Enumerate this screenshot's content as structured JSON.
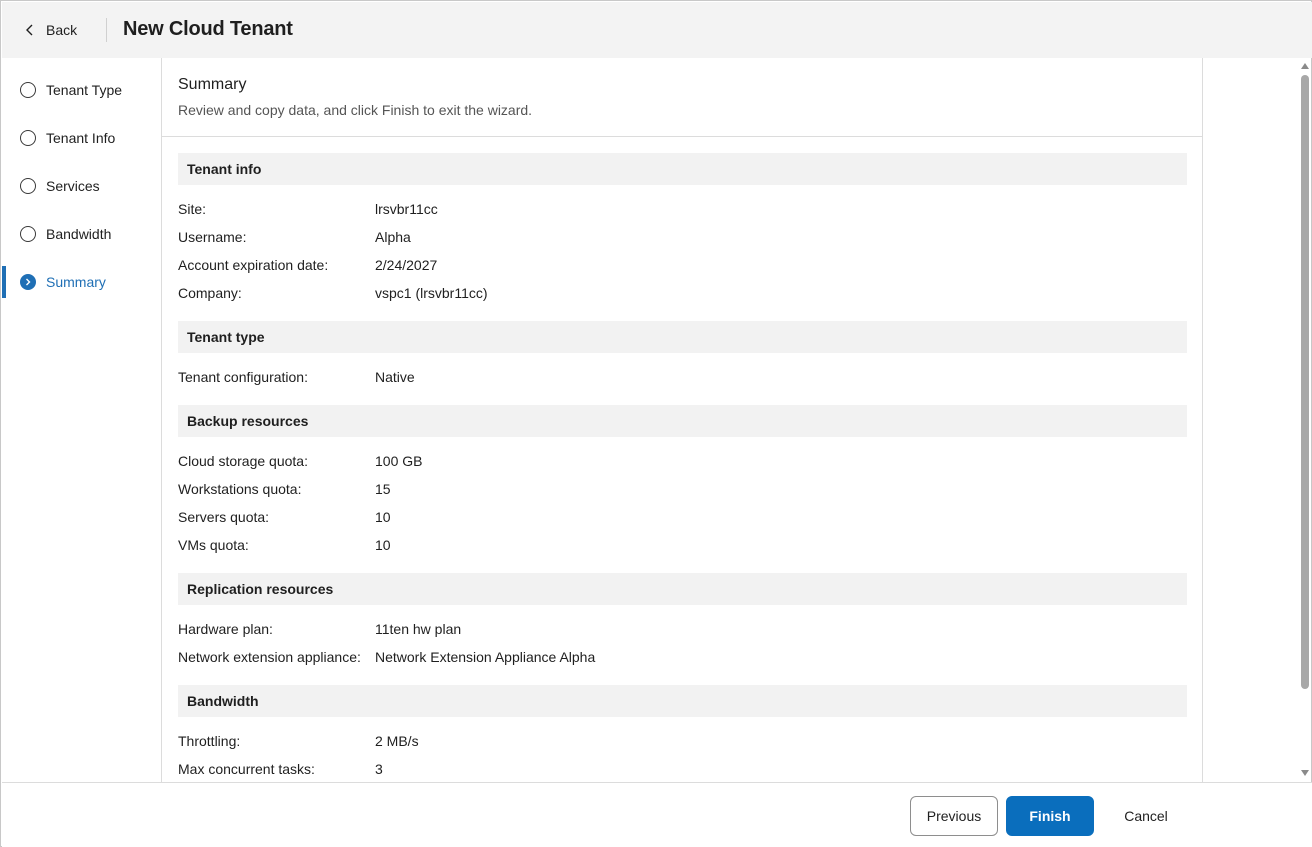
{
  "header": {
    "back_label": "Back",
    "title": "New Cloud Tenant"
  },
  "sidebar": {
    "steps": [
      {
        "label": "Tenant Type",
        "active": false
      },
      {
        "label": "Tenant Info",
        "active": false
      },
      {
        "label": "Services",
        "active": false
      },
      {
        "label": "Bandwidth",
        "active": false
      },
      {
        "label": "Summary",
        "active": true
      }
    ]
  },
  "main": {
    "title": "Summary",
    "subtitle": "Review and copy data, and click Finish to exit the wizard.",
    "sections": [
      {
        "heading": "Tenant info",
        "rows": [
          {
            "key": "Site:",
            "value": "lrsvbr11cc"
          },
          {
            "key": "Username:",
            "value": "Alpha"
          },
          {
            "key": "Account expiration date:",
            "value": "2/24/2027"
          },
          {
            "key": "Company:",
            "value": "vspc1 (lrsvbr11cc)"
          }
        ]
      },
      {
        "heading": "Tenant type",
        "rows": [
          {
            "key": "Tenant configuration:",
            "value": "Native"
          }
        ]
      },
      {
        "heading": "Backup resources",
        "rows": [
          {
            "key": "Cloud storage quota:",
            "value": "100 GB"
          },
          {
            "key": "Workstations quota:",
            "value": "15"
          },
          {
            "key": "Servers quota:",
            "value": "10"
          },
          {
            "key": "VMs quota:",
            "value": "10"
          }
        ]
      },
      {
        "heading": "Replication resources",
        "rows": [
          {
            "key": "Hardware plan:",
            "value": "11ten hw plan"
          },
          {
            "key": "Network extension appliance:",
            "value": "Network Extension Appliance Alpha"
          }
        ]
      },
      {
        "heading": "Bandwidth",
        "rows": [
          {
            "key": "Throttling:",
            "value": "2 MB/s"
          },
          {
            "key": "Max concurrent tasks:",
            "value": "3"
          }
        ]
      }
    ]
  },
  "footer": {
    "previous_label": "Previous",
    "finish_label": "Finish",
    "cancel_label": "Cancel"
  },
  "colors": {
    "accent": "#0a6ebd",
    "active_step": "#1f6fb5",
    "section_bg": "#f2f2f2",
    "header_bg": "#f3f3f3"
  }
}
